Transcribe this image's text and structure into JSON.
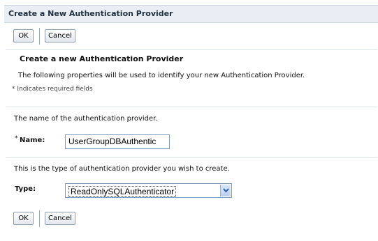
{
  "header": {
    "title": "Create a New Authentication Provider"
  },
  "toolbar": {
    "ok_label": "OK",
    "cancel_label": "Cancel"
  },
  "section": {
    "title": "Create a new Authentication Provider",
    "description": "The following properties will be used to identify your new Authentication Provider.",
    "required_note": "* Indicates required fields"
  },
  "name_field": {
    "description": "The name of the authentication provider.",
    "required_mark": "*",
    "label": "Name:",
    "value": "UserGroupDBAuthentic"
  },
  "type_field": {
    "description": "This is the type of authentication provider you wish to create.",
    "label": "Type:",
    "selected": "ReadOnlySQLAuthenticator"
  },
  "colors": {
    "header_bg": "#e9eef4",
    "border": "#7f9db9",
    "dropdown_arrow": "#2a5db0"
  },
  "icons": {
    "dropdown": "chevron-down-icon"
  }
}
